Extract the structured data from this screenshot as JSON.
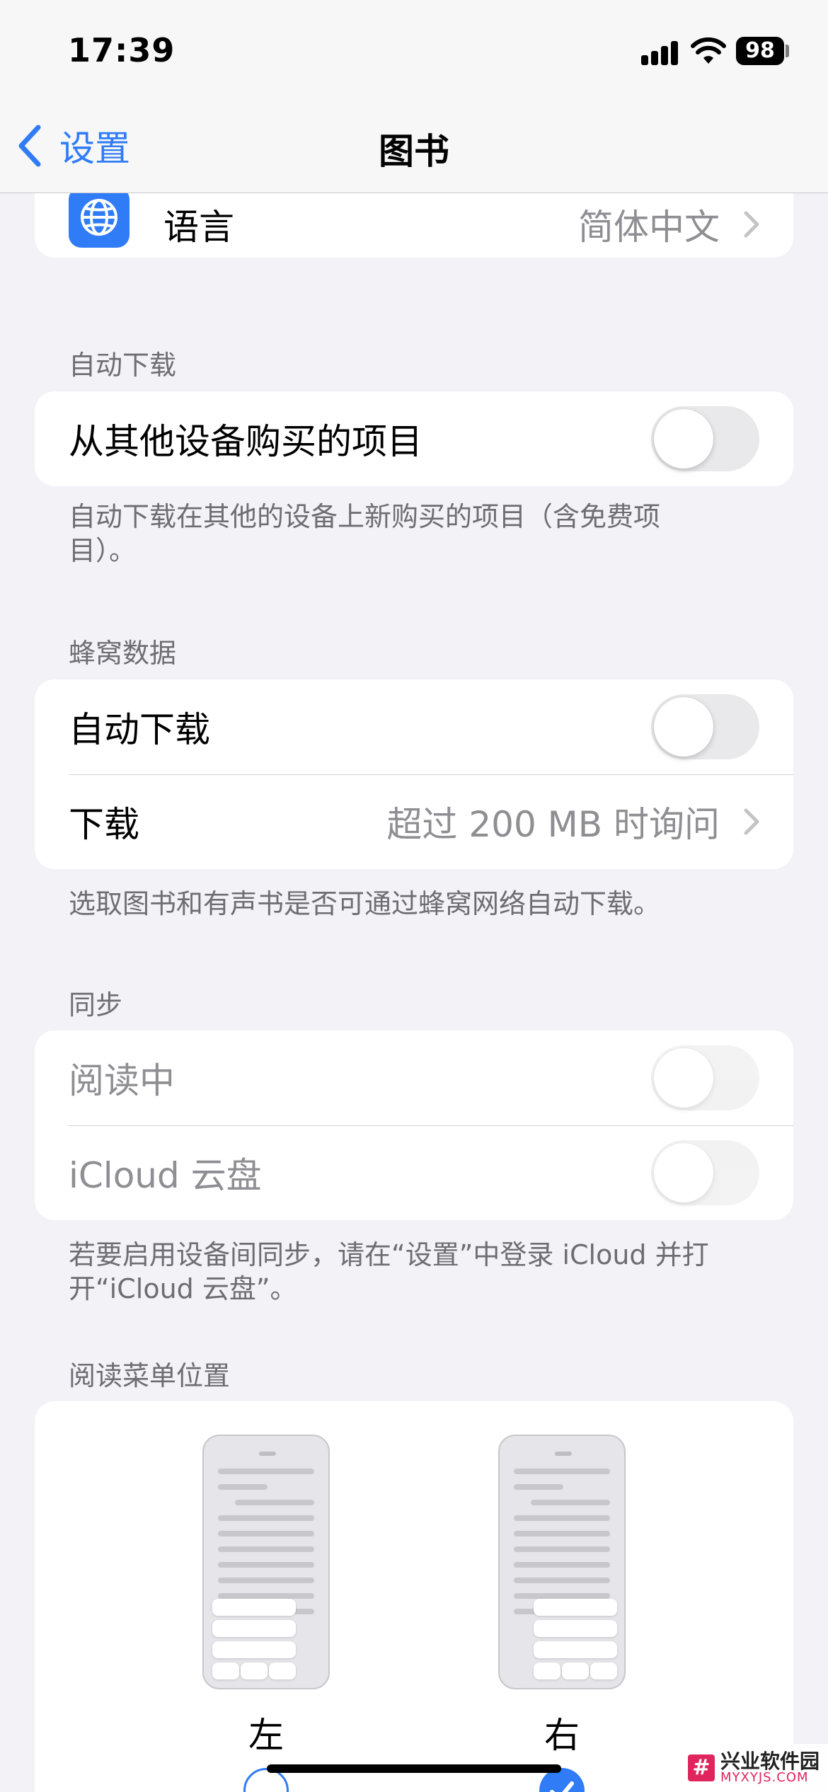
{
  "status_bar": {
    "time": "17:39",
    "battery": "98"
  },
  "nav": {
    "back_label": "设置",
    "title": "图书"
  },
  "language_row": {
    "label": "语言",
    "value": "简体中文"
  },
  "auto_download": {
    "header": "自动下载",
    "row_label": "从其他设备购买的项目",
    "toggle_on": false,
    "footer": "自动下载在其他的设备上新购买的项目（含免费项目）。"
  },
  "cellular": {
    "header": "蜂窝数据",
    "auto_download_label": "自动下载",
    "auto_download_on": false,
    "download_label": "下载",
    "download_value": "超过 200 MB 时询问",
    "footer": "选取图书和有声书是否可通过蜂窝网络自动下载。"
  },
  "sync": {
    "header": "同步",
    "reading_now_label": "阅读中",
    "reading_now_on": false,
    "icloud_drive_label": "iCloud 云盘",
    "icloud_drive_on": false,
    "footer": "若要启用设备间同步，请在“设置”中登录 iCloud 并打开“iCloud 云盘”。"
  },
  "reading_menu": {
    "header": "阅读菜单位置",
    "left_label": "左",
    "right_label": "右",
    "selected": "右"
  },
  "watermark": {
    "logo": "#",
    "line1": "兴业软件园",
    "line2": "MYXYJS.COM"
  },
  "colors": {
    "accent": "#2f7cf6",
    "background": "#f2f2f7",
    "secondary_text": "#8e8e93"
  }
}
